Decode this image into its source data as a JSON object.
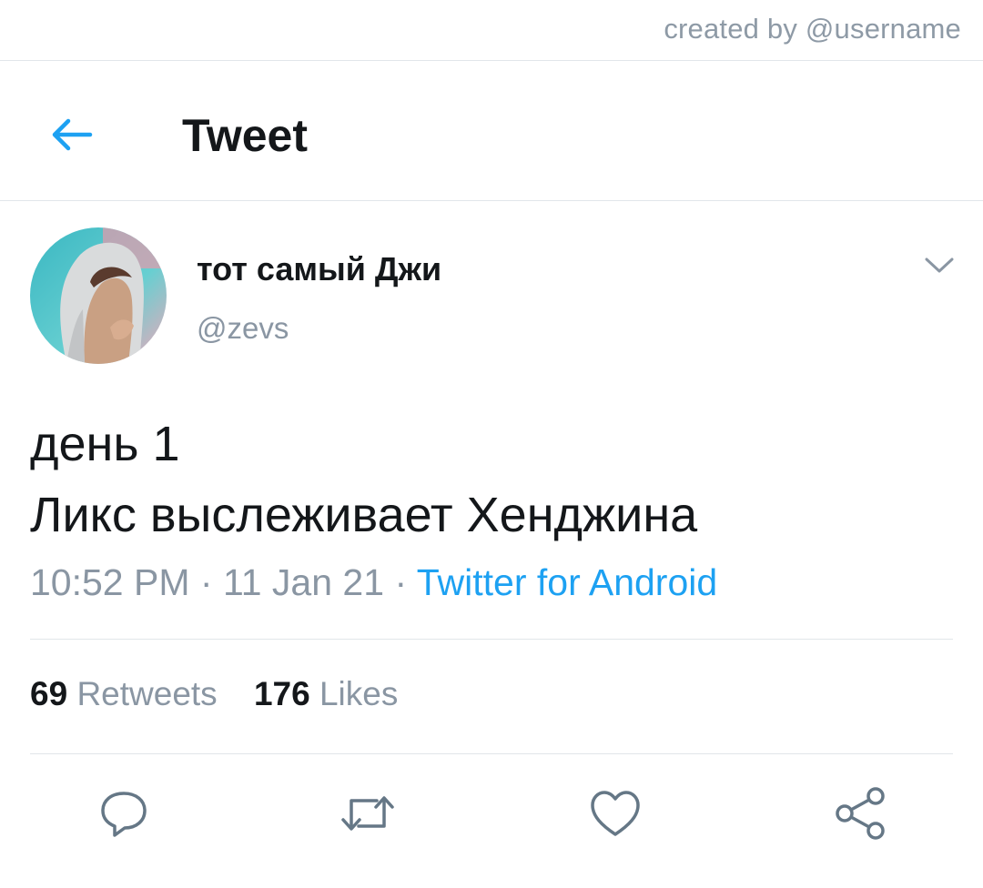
{
  "watermark": "created by @username",
  "header": {
    "title": "Tweet",
    "back_icon": "arrow-left-icon",
    "accent_color": "#1da1f2"
  },
  "tweet": {
    "author": {
      "display_name": "тот самый Джи",
      "handle": "@zevs",
      "avatar_icon": "profile-photo"
    },
    "menu_icon": "chevron-down-icon",
    "text_lines": [
      "день 1",
      "Ликс выслеживает Хенджина"
    ],
    "time": "10:52 PM",
    "date": "11 Jan 21",
    "separator": "·",
    "source": "Twitter for Android",
    "retweets": {
      "count": "69",
      "label": "Retweets"
    },
    "likes": {
      "count": "176",
      "label": "Likes"
    }
  },
  "actions": [
    {
      "name": "reply",
      "icon": "reply-icon"
    },
    {
      "name": "retweet",
      "icon": "retweet-icon"
    },
    {
      "name": "like",
      "icon": "heart-icon"
    },
    {
      "name": "share",
      "icon": "share-icon"
    }
  ],
  "colors": {
    "text_primary": "#14171a",
    "text_secondary": "#8a96a3",
    "link": "#1da1f2",
    "divider": "#e1e6ea"
  }
}
